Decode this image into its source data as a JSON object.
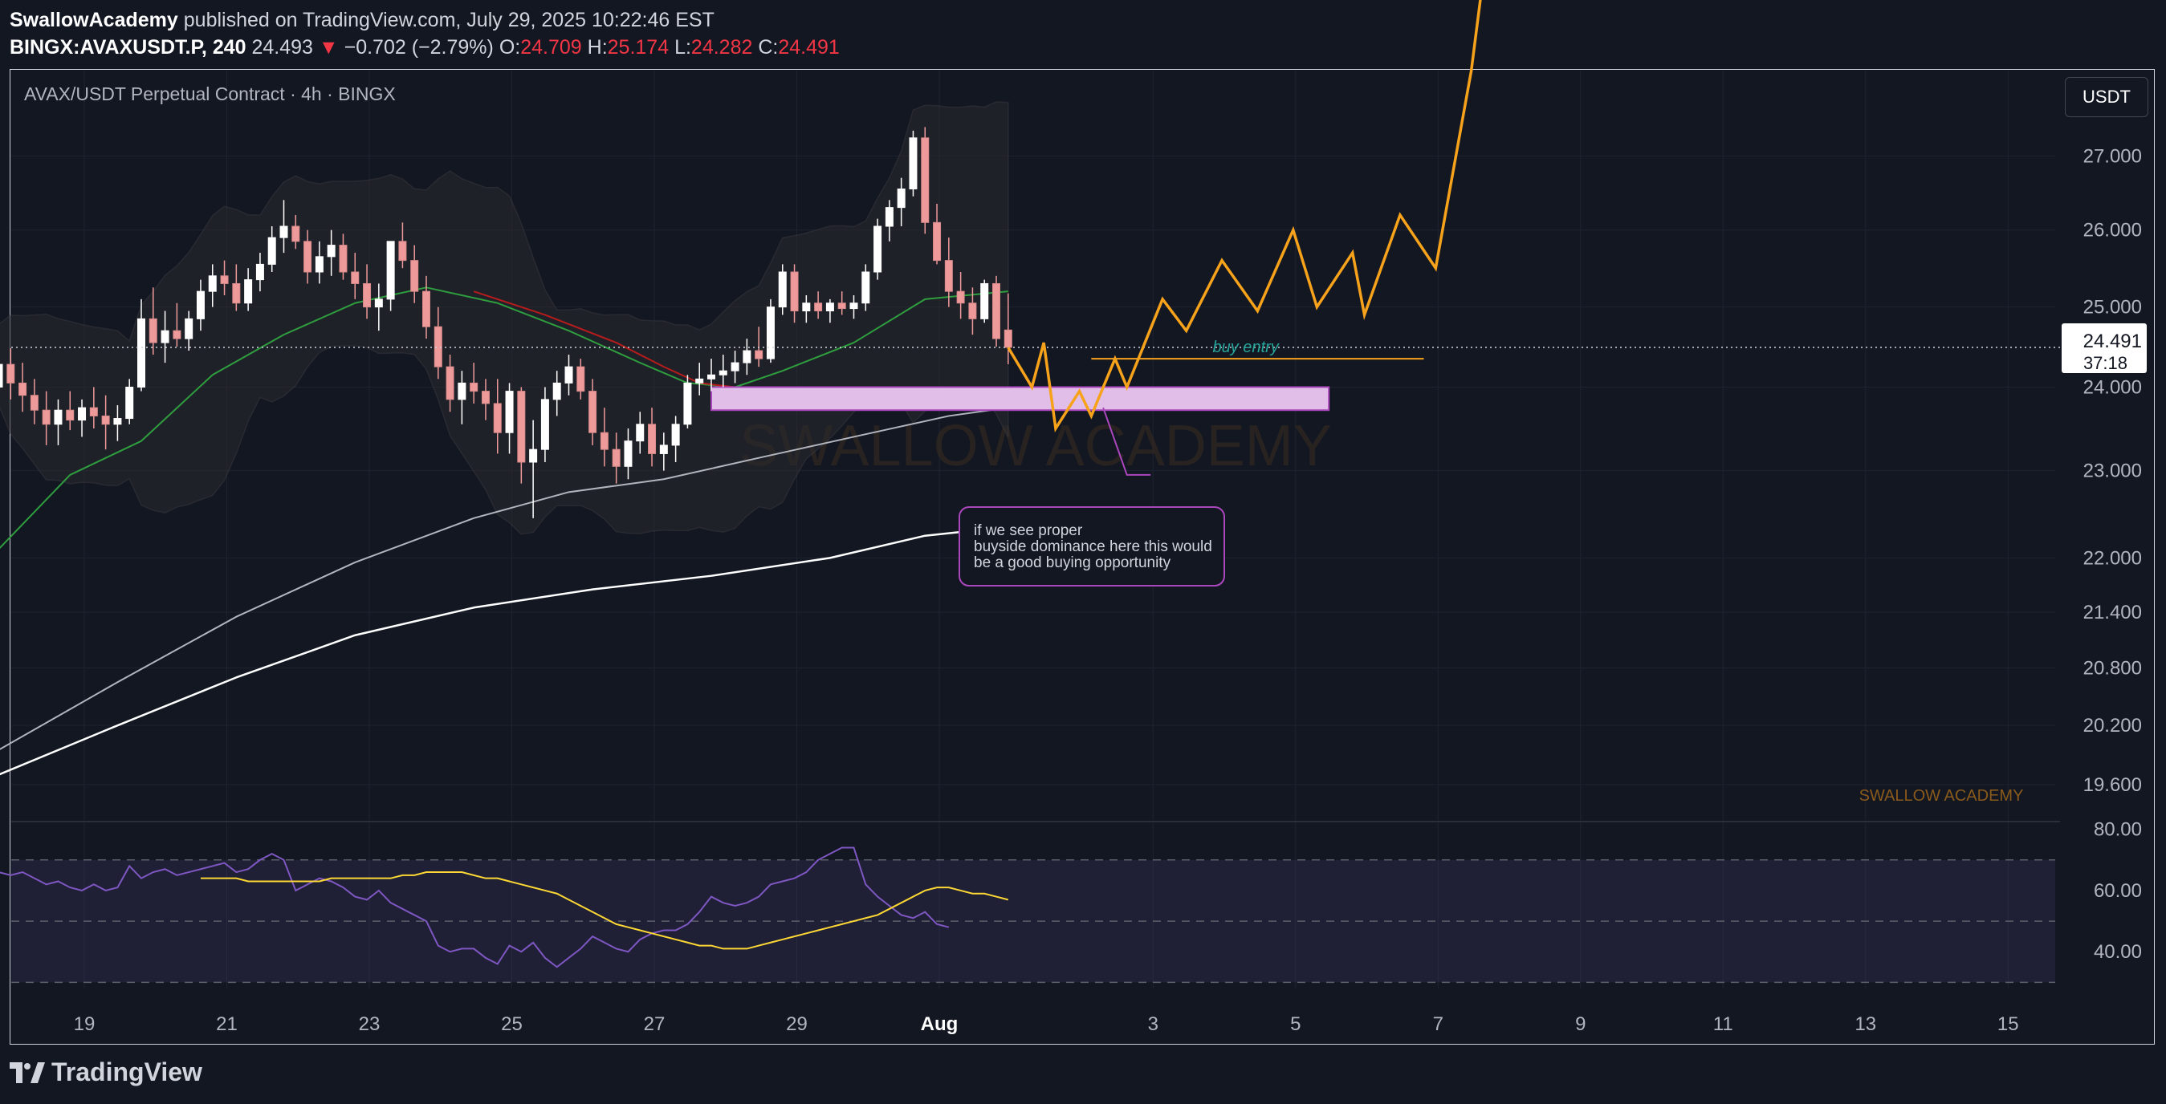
{
  "header": {
    "author": "SwallowAcademy",
    "published": "published on TradingView.com, July 29, 2025 10:22:46 EST",
    "symbol": "BINGX:AVAXUSDT.P, 240",
    "last": "24.493",
    "arrow": "▼",
    "change": "−0.702 (−2.79%)",
    "o_label": "O:",
    "o_value": "24.709",
    "h_label": "H:",
    "h_value": "25.174",
    "l_label": "L:",
    "l_value": "24.282",
    "c_label": "C:",
    "c_value": "24.491"
  },
  "pane_title": "AVAX/USDT Perpetual Contract · 4h · BINGX",
  "currency_button": "USDT",
  "watermark": "SWALLOW ACADEMY",
  "watermark_small": "SWALLOW ACADEMY",
  "brand": "TradingView",
  "colors": {
    "background": "#131722",
    "up_candle": "#ffffff",
    "down_candle": "#ef9a9a",
    "projection": "#f7a21b",
    "zone_fill": "#e1bee7",
    "zone_border": "#ab47bc",
    "rsi_line": "#7e57c2",
    "rsi_ma": "#fdd835",
    "ema_green": "#2e9e3e",
    "ema_red": "#b71c1c"
  },
  "chart_data": [
    {
      "type": "candlestick",
      "title": "AVAX/USDT Perpetual Contract · 4h · BINGX",
      "y_axis_ticks": [
        "27.000",
        "26.000",
        "25.000",
        "24.000",
        "23.000",
        "22.000",
        "21.400",
        "20.800",
        "20.200",
        "19.600"
      ],
      "x_axis_ticks": [
        "19",
        "21",
        "23",
        "25",
        "27",
        "29",
        "Aug",
        "3",
        "5",
        "7",
        "9",
        "11",
        "13",
        "15"
      ],
      "y_scale": "log",
      "ylim": [
        19.25,
        28.2
      ],
      "x_range_days": [
        17.95,
        16.25
      ],
      "last_price_label": "24.491",
      "countdown_label": "37:18",
      "candles": [
        {
          "o": 24.0,
          "h": 24.42,
          "l": 23.78,
          "c": 24.28
        },
        {
          "o": 24.28,
          "h": 24.48,
          "l": 23.85,
          "c": 24.05
        },
        {
          "o": 24.05,
          "h": 24.3,
          "l": 23.7,
          "c": 23.9
        },
        {
          "o": 23.9,
          "h": 24.1,
          "l": 23.55,
          "c": 23.72
        },
        {
          "o": 23.72,
          "h": 23.95,
          "l": 23.3,
          "c": 23.55
        },
        {
          "o": 23.55,
          "h": 23.85,
          "l": 23.3,
          "c": 23.72
        },
        {
          "o": 23.72,
          "h": 23.95,
          "l": 23.48,
          "c": 23.6
        },
        {
          "o": 23.6,
          "h": 23.85,
          "l": 23.4,
          "c": 23.75
        },
        {
          "o": 23.75,
          "h": 24.0,
          "l": 23.5,
          "c": 23.65
        },
        {
          "o": 23.65,
          "h": 23.9,
          "l": 23.25,
          "c": 23.55
        },
        {
          "o": 23.55,
          "h": 23.78,
          "l": 23.35,
          "c": 23.62
        },
        {
          "o": 23.62,
          "h": 24.1,
          "l": 23.55,
          "c": 24.0
        },
        {
          "o": 24.0,
          "h": 25.1,
          "l": 23.95,
          "c": 24.85
        },
        {
          "o": 24.85,
          "h": 25.25,
          "l": 24.4,
          "c": 24.55
        },
        {
          "o": 24.55,
          "h": 24.95,
          "l": 24.3,
          "c": 24.7
        },
        {
          "o": 24.7,
          "h": 25.05,
          "l": 24.5,
          "c": 24.6
        },
        {
          "o": 24.6,
          "h": 24.95,
          "l": 24.45,
          "c": 24.85
        },
        {
          "o": 24.85,
          "h": 25.35,
          "l": 24.7,
          "c": 25.2
        },
        {
          "o": 25.2,
          "h": 25.55,
          "l": 25.0,
          "c": 25.4
        },
        {
          "o": 25.4,
          "h": 25.6,
          "l": 25.15,
          "c": 25.3
        },
        {
          "o": 25.3,
          "h": 25.55,
          "l": 24.95,
          "c": 25.05
        },
        {
          "o": 25.05,
          "h": 25.5,
          "l": 24.95,
          "c": 25.35
        },
        {
          "o": 25.35,
          "h": 25.7,
          "l": 25.2,
          "c": 25.55
        },
        {
          "o": 25.55,
          "h": 26.05,
          "l": 25.45,
          "c": 25.9
        },
        {
          "o": 25.9,
          "h": 26.4,
          "l": 25.7,
          "c": 26.05
        },
        {
          "o": 26.05,
          "h": 26.2,
          "l": 25.75,
          "c": 25.85
        },
        {
          "o": 25.85,
          "h": 26.0,
          "l": 25.3,
          "c": 25.45
        },
        {
          "o": 25.45,
          "h": 25.85,
          "l": 25.3,
          "c": 25.65
        },
        {
          "o": 25.65,
          "h": 26.0,
          "l": 25.4,
          "c": 25.8
        },
        {
          "o": 25.8,
          "h": 25.95,
          "l": 25.35,
          "c": 25.45
        },
        {
          "o": 25.45,
          "h": 25.7,
          "l": 25.1,
          "c": 25.3
        },
        {
          "o": 25.3,
          "h": 25.55,
          "l": 24.85,
          "c": 25.0
        },
        {
          "o": 25.0,
          "h": 25.3,
          "l": 24.7,
          "c": 25.1
        },
        {
          "o": 25.1,
          "h": 25.85,
          "l": 24.95,
          "c": 25.85
        },
        {
          "o": 25.85,
          "h": 26.1,
          "l": 25.5,
          "c": 25.6
        },
        {
          "o": 25.6,
          "h": 25.8,
          "l": 25.05,
          "c": 25.2
        },
        {
          "o": 25.2,
          "h": 25.4,
          "l": 24.6,
          "c": 24.75
        },
        {
          "o": 24.75,
          "h": 25.0,
          "l": 24.1,
          "c": 24.25
        },
        {
          "o": 24.25,
          "h": 24.4,
          "l": 23.7,
          "c": 23.85
        },
        {
          "o": 23.85,
          "h": 24.2,
          "l": 23.55,
          "c": 24.05
        },
        {
          "o": 24.05,
          "h": 24.3,
          "l": 23.8,
          "c": 23.95
        },
        {
          "o": 23.95,
          "h": 24.1,
          "l": 23.6,
          "c": 23.8
        },
        {
          "o": 23.8,
          "h": 24.1,
          "l": 23.2,
          "c": 23.45
        },
        {
          "o": 23.45,
          "h": 24.05,
          "l": 23.2,
          "c": 23.95
        },
        {
          "o": 23.95,
          "h": 24.0,
          "l": 22.85,
          "c": 23.1
        },
        {
          "o": 23.1,
          "h": 23.6,
          "l": 22.45,
          "c": 23.25
        },
        {
          "o": 23.25,
          "h": 24.0,
          "l": 23.1,
          "c": 23.85
        },
        {
          "o": 23.85,
          "h": 24.2,
          "l": 23.65,
          "c": 24.05
        },
        {
          "o": 24.05,
          "h": 24.4,
          "l": 23.9,
          "c": 24.25
        },
        {
          "o": 24.25,
          "h": 24.35,
          "l": 23.85,
          "c": 23.95
        },
        {
          "o": 23.95,
          "h": 24.1,
          "l": 23.3,
          "c": 23.45
        },
        {
          "o": 23.45,
          "h": 23.75,
          "l": 23.05,
          "c": 23.25
        },
        {
          "o": 23.25,
          "h": 23.45,
          "l": 22.85,
          "c": 23.05
        },
        {
          "o": 23.05,
          "h": 23.5,
          "l": 22.9,
          "c": 23.35
        },
        {
          "o": 23.35,
          "h": 23.7,
          "l": 23.2,
          "c": 23.55
        },
        {
          "o": 23.55,
          "h": 23.75,
          "l": 23.05,
          "c": 23.2
        },
        {
          "o": 23.2,
          "h": 23.45,
          "l": 23.0,
          "c": 23.3
        },
        {
          "o": 23.3,
          "h": 23.65,
          "l": 23.1,
          "c": 23.55
        },
        {
          "o": 23.55,
          "h": 24.15,
          "l": 23.5,
          "c": 24.05
        },
        {
          "o": 24.05,
          "h": 24.3,
          "l": 23.9,
          "c": 24.1
        },
        {
          "o": 24.1,
          "h": 24.35,
          "l": 23.95,
          "c": 24.15
        },
        {
          "o": 24.15,
          "h": 24.4,
          "l": 24.0,
          "c": 24.2
        },
        {
          "o": 24.2,
          "h": 24.45,
          "l": 24.05,
          "c": 24.3
        },
        {
          "o": 24.3,
          "h": 24.6,
          "l": 24.15,
          "c": 24.45
        },
        {
          "o": 24.45,
          "h": 24.75,
          "l": 24.25,
          "c": 24.35
        },
        {
          "o": 24.35,
          "h": 25.1,
          "l": 24.3,
          "c": 25.0
        },
        {
          "o": 25.0,
          "h": 25.55,
          "l": 24.9,
          "c": 25.45
        },
        {
          "o": 25.45,
          "h": 25.55,
          "l": 24.8,
          "c": 24.95
        },
        {
          "o": 24.95,
          "h": 25.15,
          "l": 24.8,
          "c": 25.05
        },
        {
          "o": 25.05,
          "h": 25.2,
          "l": 24.85,
          "c": 24.95
        },
        {
          "o": 24.95,
          "h": 25.1,
          "l": 24.8,
          "c": 25.05
        },
        {
          "o": 25.05,
          "h": 25.2,
          "l": 24.9,
          "c": 24.98
        },
        {
          "o": 24.98,
          "h": 25.15,
          "l": 24.85,
          "c": 25.05
        },
        {
          "o": 25.05,
          "h": 25.55,
          "l": 24.95,
          "c": 25.45
        },
        {
          "o": 25.45,
          "h": 26.15,
          "l": 25.35,
          "c": 26.05
        },
        {
          "o": 26.05,
          "h": 26.4,
          "l": 25.85,
          "c": 26.3
        },
        {
          "o": 26.3,
          "h": 26.7,
          "l": 26.05,
          "c": 26.55
        },
        {
          "o": 26.55,
          "h": 27.35,
          "l": 26.45,
          "c": 27.25
        },
        {
          "o": 27.25,
          "h": 27.4,
          "l": 25.95,
          "c": 26.1
        },
        {
          "o": 26.1,
          "h": 26.35,
          "l": 25.55,
          "c": 25.6
        },
        {
          "o": 25.6,
          "h": 25.9,
          "l": 25.0,
          "c": 25.2
        },
        {
          "o": 25.2,
          "h": 25.45,
          "l": 24.85,
          "c": 25.05
        },
        {
          "o": 25.05,
          "h": 25.25,
          "l": 24.65,
          "c": 24.85
        },
        {
          "o": 24.85,
          "h": 25.35,
          "l": 24.8,
          "c": 25.3
        },
        {
          "o": 25.3,
          "h": 25.4,
          "l": 24.5,
          "c": 24.6
        },
        {
          "o": 24.709,
          "h": 25.174,
          "l": 24.282,
          "c": 24.491
        }
      ],
      "ema_fast": [
        [
          0,
          22.1
        ],
        [
          6,
          22.95
        ],
        [
          12,
          23.35
        ],
        [
          18,
          24.15
        ],
        [
          24,
          24.65
        ],
        [
          30,
          25.05
        ],
        [
          36,
          25.25
        ],
        [
          42,
          25.05
        ],
        [
          48,
          24.7
        ],
        [
          54,
          24.3
        ],
        [
          58,
          24.05
        ],
        [
          62,
          24.0
        ],
        [
          66,
          24.2
        ],
        [
          72,
          24.55
        ],
        [
          78,
          25.1
        ],
        [
          85,
          25.2
        ]
      ],
      "ema_slow": [
        [
          0,
          19.95
        ],
        [
          10,
          20.65
        ],
        [
          20,
          21.35
        ],
        [
          30,
          21.95
        ],
        [
          40,
          22.45
        ],
        [
          48,
          22.75
        ],
        [
          56,
          22.9
        ],
        [
          64,
          23.15
        ],
        [
          72,
          23.4
        ],
        [
          80,
          23.65
        ],
        [
          85,
          23.75
        ]
      ],
      "ema_200": [
        [
          0,
          19.7
        ],
        [
          10,
          20.2
        ],
        [
          20,
          20.7
        ],
        [
          30,
          21.15
        ],
        [
          40,
          21.45
        ],
        [
          50,
          21.65
        ],
        [
          60,
          21.8
        ],
        [
          70,
          22.0
        ],
        [
          78,
          22.25
        ],
        [
          85,
          22.35
        ]
      ],
      "ema_red_segment": [
        [
          40,
          25.2
        ],
        [
          46,
          24.9
        ],
        [
          52,
          24.55
        ],
        [
          56,
          24.25
        ],
        [
          59,
          24.05
        ],
        [
          62,
          24.0
        ]
      ],
      "buy_zone": {
        "x0": 60,
        "x1": 112,
        "y_top": 24.0,
        "y_bottom": 23.72
      },
      "buy_entry_line": {
        "label": "buy entry",
        "x0": 92,
        "x1": 120,
        "y": 24.35
      },
      "projection_path": [
        [
          85,
          24.49
        ],
        [
          87,
          24.0
        ],
        [
          88,
          24.55
        ],
        [
          89,
          23.5
        ],
        [
          91,
          23.95
        ],
        [
          92,
          23.65
        ],
        [
          94,
          24.35
        ],
        [
          95,
          24.0
        ],
        [
          98,
          25.1
        ],
        [
          100,
          24.7
        ],
        [
          103,
          25.6
        ],
        [
          106,
          24.95
        ],
        [
          109,
          26.0
        ],
        [
          111,
          25.0
        ],
        [
          114,
          25.7
        ],
        [
          115,
          24.9
        ],
        [
          118,
          26.2
        ],
        [
          121,
          25.5
        ],
        [
          124,
          28.2
        ],
        [
          126,
          31.0
        ]
      ],
      "note": {
        "text": "if we see proper buyside dominance here this would be a good buying opportunity"
      }
    },
    {
      "type": "line",
      "title": "",
      "y_axis_ticks": [
        "80.00",
        "60.00",
        "40.00"
      ],
      "ylim": [
        28,
        82
      ],
      "bands": [
        70,
        50,
        30
      ],
      "series": [
        {
          "values": [
            66,
            65,
            66,
            64,
            62,
            63,
            61,
            60,
            62,
            60,
            61,
            68,
            64,
            66,
            67,
            65,
            66,
            67,
            68,
            69,
            66,
            67,
            70,
            72,
            70,
            60,
            62,
            64,
            63,
            61,
            58,
            57,
            60,
            56,
            54,
            52,
            50,
            42,
            40,
            41,
            41,
            38,
            36,
            42,
            40,
            43,
            38,
            35,
            38,
            41,
            45,
            43,
            41,
            40,
            44,
            46,
            47,
            47,
            49,
            53,
            58,
            56,
            55,
            56,
            58,
            62,
            63,
            64,
            66,
            70,
            72,
            74,
            74,
            62,
            58,
            55,
            52,
            51,
            53,
            49,
            48
          ]
        },
        {
          "values": [
            64,
            64,
            64,
            64,
            63,
            63,
            63,
            63,
            63,
            63,
            63,
            64,
            64,
            64,
            64,
            64,
            64,
            65,
            65,
            66,
            66,
            66,
            66,
            65,
            64,
            64,
            63,
            62,
            61,
            60,
            59,
            57,
            55,
            53,
            51,
            49,
            48,
            47,
            46,
            45,
            44,
            43,
            42,
            42,
            41,
            41,
            41,
            42,
            43,
            44,
            45,
            46,
            47,
            48,
            49,
            50,
            51,
            52,
            54,
            56,
            58,
            60,
            61,
            61,
            60,
            59,
            59,
            58,
            57
          ]
        }
      ]
    }
  ]
}
